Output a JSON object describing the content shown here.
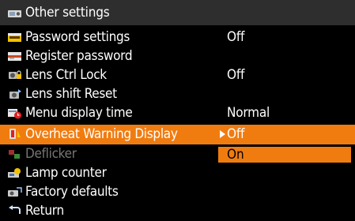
{
  "header": {
    "title": "Other settings",
    "icon": "projector-settings-icon"
  },
  "rows": [
    {
      "label": "Password settings",
      "value": "Off",
      "icon": "password-key-icon"
    },
    {
      "label": "Register password",
      "value": "",
      "icon": "register-password-icon"
    },
    {
      "label": "Lens Ctrl Lock",
      "value": "Off",
      "icon": "lens-lock-icon"
    },
    {
      "label": "Lens shift Reset",
      "value": "",
      "icon": "lens-shift-icon"
    },
    {
      "label": "Menu display time",
      "value": "Normal",
      "icon": "menu-time-icon"
    },
    {
      "label": "Overheat Warning Display",
      "value": "Off",
      "icon": "overheat-warning-icon"
    },
    {
      "label": "Deflicker",
      "value": "",
      "icon": "deflicker-icon"
    },
    {
      "label": "Lamp counter",
      "value": "",
      "icon": "lamp-counter-icon"
    },
    {
      "label": "Factory defaults",
      "value": "",
      "icon": "factory-defaults-icon"
    },
    {
      "label": "Return",
      "value": "",
      "icon": "return-icon"
    }
  ],
  "dropdown": {
    "option_on": "On"
  },
  "colors": {
    "highlight": "#f07c10",
    "background": "#000000",
    "header": "#2e2e2e",
    "disabled_text": "#777777"
  }
}
